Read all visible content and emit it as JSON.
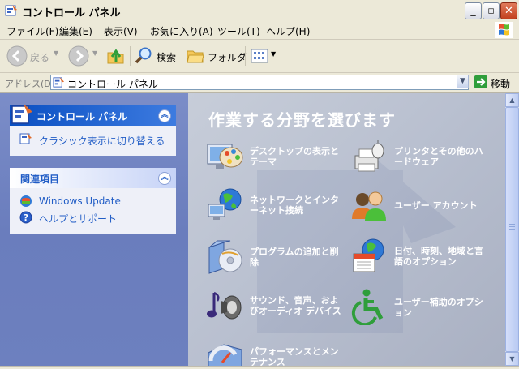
{
  "window": {
    "title": "コントロール パネル"
  },
  "menu": {
    "items": [
      "ファイル(F)",
      "編集(E)",
      "表示(V)",
      "お気に入り(A)",
      "ツール(T)",
      "ヘルプ(H)"
    ]
  },
  "toolbar": {
    "back_label": "戻る",
    "search_label": "検索",
    "folders_label": "フォルダ"
  },
  "address": {
    "label": "アドレス(D)",
    "value": "コントロール パネル",
    "go_label": "移動"
  },
  "left": {
    "control_panel_box": {
      "title": "コントロール パネル",
      "link": "クラシック表示に切り替える"
    },
    "related_box": {
      "title": "関連項目",
      "links": [
        "Windows Update",
        "ヘルプとサポート"
      ]
    }
  },
  "main": {
    "heading": "作業する分野を選びます",
    "categories": [
      {
        "label": "デスクトップの表示とテーマ",
        "icon": "display-icon"
      },
      {
        "label": "プリンタとその他のハードウェア",
        "icon": "printer-icon"
      },
      {
        "label": "ネットワークとインターネット接続",
        "icon": "network-icon"
      },
      {
        "label": "ユーザー アカウント",
        "icon": "user-accounts-icon"
      },
      {
        "label": "プログラムの追加と削除",
        "icon": "add-remove-programs-icon"
      },
      {
        "label": "日付、時刻、地域と言語のオプション",
        "icon": "date-time-icon"
      },
      {
        "label": "サウンド、音声、およびオーディオ デバイス",
        "icon": "sound-icon"
      },
      {
        "label": "ユーザー補助のオプション",
        "icon": "accessibility-icon"
      },
      {
        "label": "パフォーマンスとメンテナンス",
        "icon": "performance-icon"
      }
    ]
  },
  "colors": {
    "link_blue": "#215dc6",
    "pane_blue": "#6d80bf",
    "main_bg": "#b8bfcf",
    "go_green": "#2f9e3b"
  }
}
